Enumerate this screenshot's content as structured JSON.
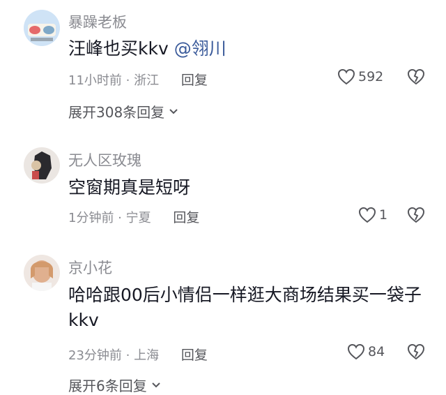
{
  "comments": [
    {
      "username": "暴躁老板",
      "text": "汪峰也买kkv",
      "mention": "@翎川",
      "time": "11小时前",
      "location": "浙江",
      "reply_label": "回复",
      "likes": "592",
      "expand_label": "展开308条回复",
      "avatar_colors": [
        "#cfe3f6",
        "#7fa8c7"
      ]
    },
    {
      "username": "无人区玫瑰",
      "text": "空窗期真是短呀",
      "time": "1分钟前",
      "location": "宁夏",
      "reply_label": "回复",
      "likes": "1",
      "avatar_colors": [
        "#2b2a2e",
        "#d9c3a5"
      ]
    },
    {
      "username": "京小花",
      "text": "哈哈跟00后小情侣一样逛大商场结果买一袋子kkv",
      "time": "23分钟前",
      "location": "上海",
      "reply_label": "回复",
      "likes": "84",
      "expand_label": "展开6条回复",
      "avatar_colors": [
        "#efe7e2",
        "#e0b08f"
      ]
    }
  ],
  "icons": {
    "like": "heart-outline-icon",
    "dislike": "broken-heart-icon",
    "expand": "chevron-down-icon"
  }
}
